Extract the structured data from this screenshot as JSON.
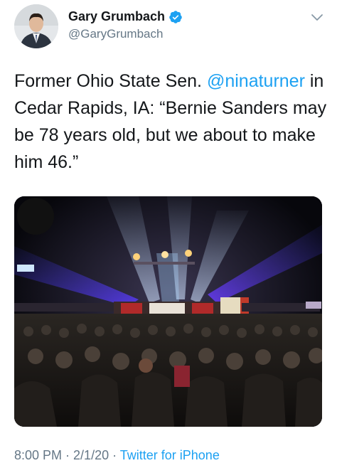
{
  "header": {
    "display_name": "Gary Grumbach",
    "handle": "@GaryGrumbach",
    "verified_icon": "verified-badge-icon",
    "menu_icon": "chevron-down-icon"
  },
  "tweet": {
    "text_before": "Former Ohio State Sen. ",
    "mention": "@ninaturner",
    "text_after": " in Cedar Rapids, IA: “Bernie Sanders may be 78 years old, but we about to make him 46.”"
  },
  "footer": {
    "time": "8:00 PM",
    "sep1": " · ",
    "date": "2/1/20",
    "sep2": " · ",
    "source": "Twitter for iPhone"
  },
  "colors": {
    "link": "#1da1f2",
    "secondary": "#657786",
    "text": "#14171a"
  }
}
